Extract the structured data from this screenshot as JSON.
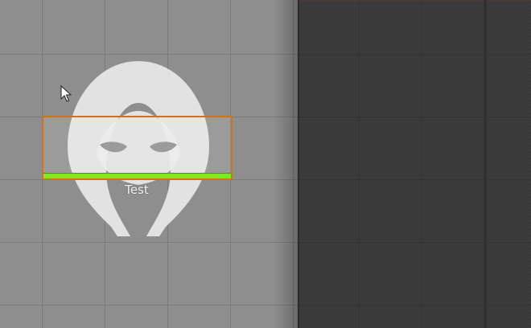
{
  "node": {
    "label": "Test",
    "health_fraction": 1.0,
    "icon": "hooded-figure-icon"
  },
  "colors": {
    "selection_outline": "#c9761e",
    "health_fill": "#7fe81f",
    "canvas_background": "#8e8e8e",
    "panel_background": "#3a3a3a"
  },
  "cursor": {
    "icon": "mouse-pointer-icon"
  }
}
